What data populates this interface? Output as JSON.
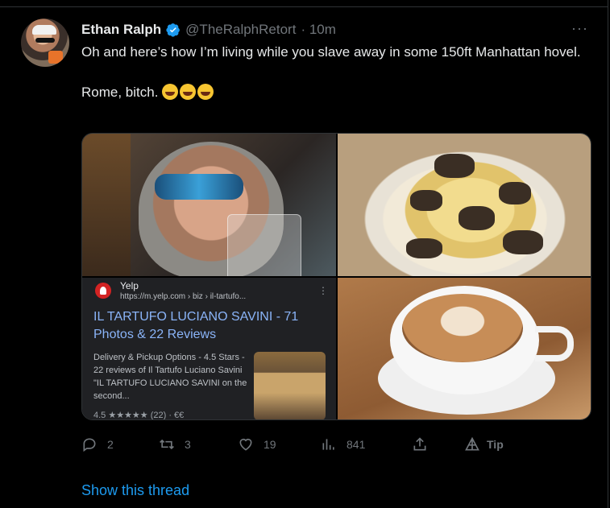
{
  "tweet": {
    "name": "Ethan Ralph",
    "handle": "@TheRalphRetort",
    "time": "· 10m",
    "more_label": "···",
    "text_line1": "Oh and here’s how I’m living while you slave away in some 150ft Manhattan hovel.",
    "text_line2": "Rome, bitch."
  },
  "yelp_card": {
    "site": "Yelp",
    "url": "https://m.yelp.com › biz › il-tartufo...",
    "dots": "⋮",
    "title": "IL TARTUFO LUCIANO SAVINI - 71 Photos & 22 Reviews",
    "description": "Delivery & Pickup Options - 4.5 Stars - 22 reviews of Il Tartufo Luciano Savini \"IL TARTUFO LUCIANO SAVINI on the second...",
    "rating_text": "4.5 ★★★★★ (22) · €€"
  },
  "actions": {
    "reply_count": "2",
    "retweet_count": "3",
    "like_count": "19",
    "views_count": "841",
    "tip_label": "Tip"
  },
  "show_thread": "Show this thread",
  "colors": {
    "background": "#000000",
    "accent": "#1d9bf0",
    "muted": "#71767b",
    "text": "#e7e9ea"
  }
}
